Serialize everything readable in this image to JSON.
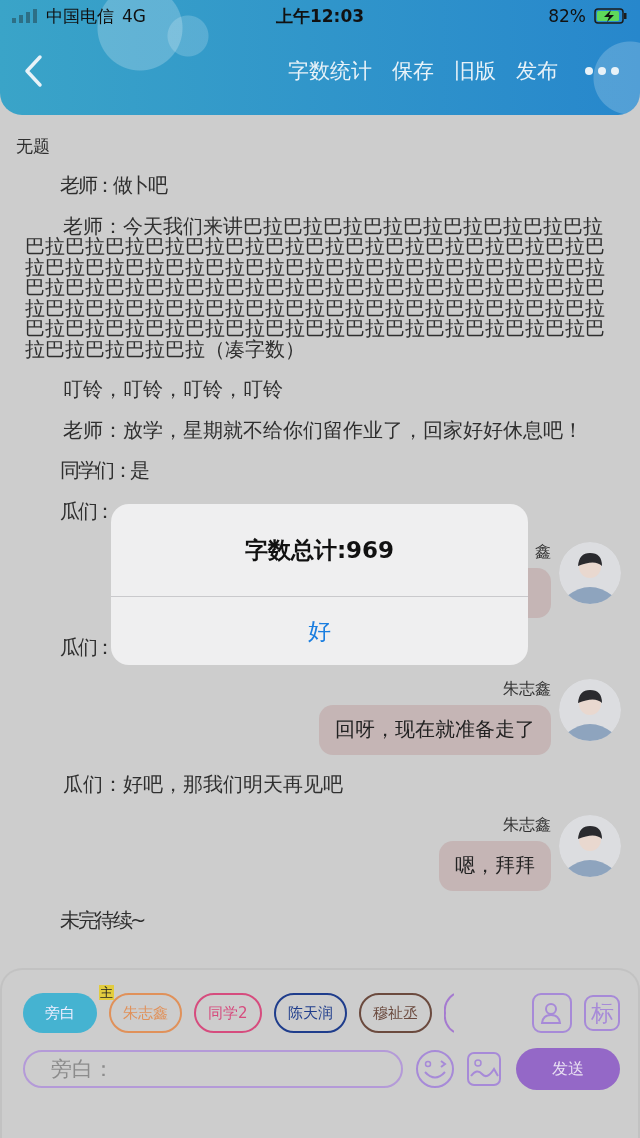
{
  "status_bar": {
    "carrier": "中国电信",
    "network": "4G",
    "time": "上午12:03",
    "battery": "82%"
  },
  "nav": {
    "actions": [
      "字数统计",
      "保存",
      "旧版",
      "发布"
    ]
  },
  "document": {
    "title": "无题",
    "blocks": [
      {
        "kind": "line",
        "text": "老师：做卜吧"
      },
      {
        "kind": "line",
        "text": "老师：今天我们来讲巴拉巴拉巴拉巴拉巴拉巴拉巴拉巴拉巴拉巴拉巴拉巴拉巴拉巴拉巴拉巴拉巴拉巴拉巴拉巴拉巴拉巴拉巴拉巴拉巴拉巴拉巴拉巴拉巴拉巴拉巴拉巴拉巴拉巴拉巴拉巴拉巴拉巴拉巴拉巴拉巴拉巴拉巴拉巴拉巴拉巴拉巴拉巴拉巴拉巴拉巴拉巴拉巴拉巴拉巴拉巴拉巴拉巴拉巴拉巴拉巴拉巴拉巴拉巴拉巴拉巴拉巴拉巴拉巴拉巴拉巴拉巴拉巴拉巴拉巴拉巴拉巴拉巴拉巴拉巴拉巴拉巴拉巴拉巴拉巴拉巴拉（凑字数）"
      },
      {
        "kind": "line",
        "text": "叮铃，叮铃，叮铃，叮铃"
      },
      {
        "kind": "line",
        "text": "老师：放学，星期就不给你们留作业了，回家好好休息吧！"
      },
      {
        "kind": "line",
        "text": "同学们：是"
      },
      {
        "kind": "line",
        "text": "瓜们："
      },
      {
        "kind": "bubble",
        "name": "鑫"
      },
      {
        "kind": "line",
        "text": "瓜们："
      },
      {
        "kind": "bubble",
        "name": "朱志鑫",
        "text": "回呀，现在就准备走了"
      },
      {
        "kind": "line",
        "text": "瓜们：好吧，那我们明天再见吧"
      },
      {
        "kind": "bubble",
        "name": "朱志鑫",
        "text": "嗯，拜拜"
      },
      {
        "kind": "line",
        "text": "未完待续~"
      }
    ]
  },
  "composer": {
    "roles": [
      {
        "label": "旁白",
        "color": "#45b3d1",
        "selected": true
      },
      {
        "label": "朱志鑫",
        "color": "#e0915a",
        "selected": false,
        "badge": "主"
      },
      {
        "label": "同学2",
        "color": "#d64c7e",
        "selected": false
      },
      {
        "label": "陈天润",
        "color": "#1f3d8c",
        "selected": false
      },
      {
        "label": "穆祉丞",
        "color": "#6b4a3e",
        "selected": false
      },
      {
        "color": "#a57ad0",
        "selected": false
      }
    ],
    "tag_button": "标",
    "input": {
      "placeholder": "旁白："
    },
    "send": "发送"
  },
  "dialog": {
    "message": "字数总计:969",
    "button": "好"
  }
}
